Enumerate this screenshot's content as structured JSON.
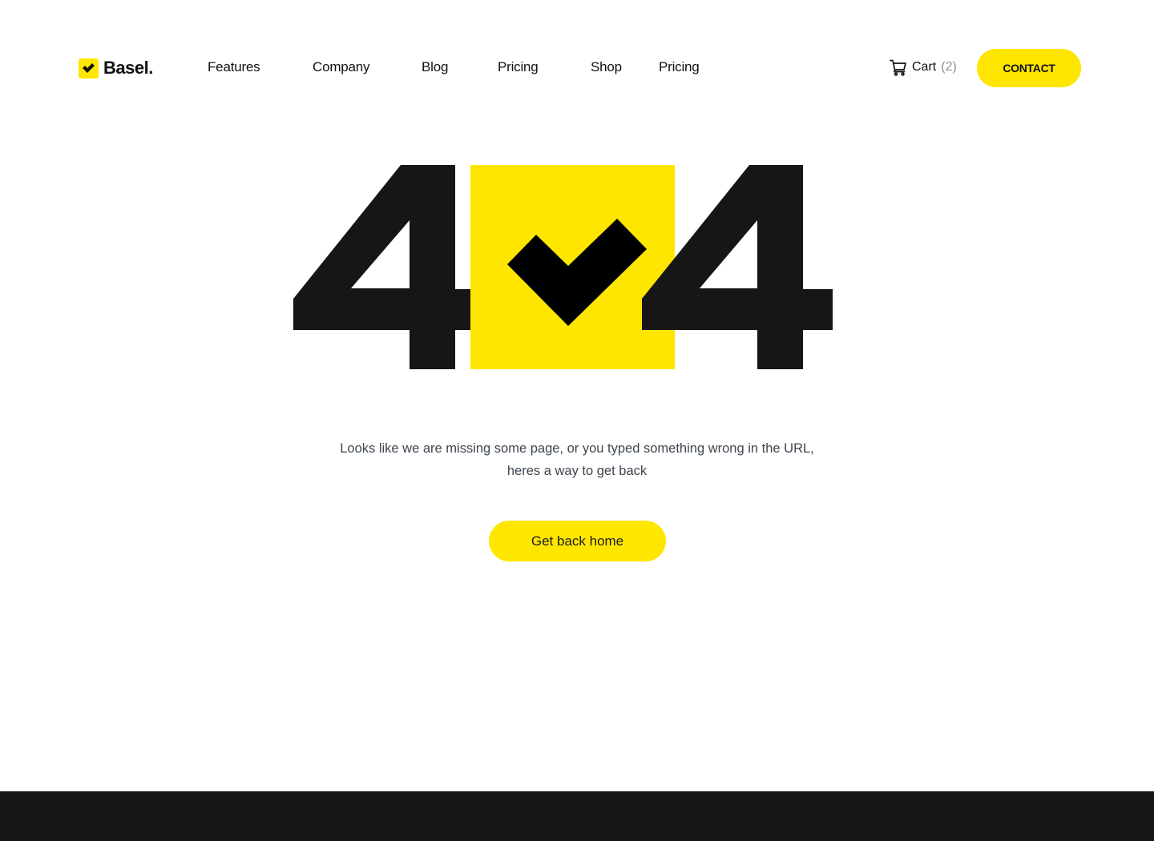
{
  "brand": {
    "name": "Basel.",
    "logo_icon": "checkmark-icon",
    "accent_color": "#ffe600",
    "dark_color": "#161616"
  },
  "nav": {
    "items": [
      {
        "label": "Features"
      },
      {
        "label": "Company"
      },
      {
        "label": "Blog"
      },
      {
        "label": "Pricing"
      },
      {
        "label": "Shop"
      },
      {
        "label": "Pricing"
      }
    ]
  },
  "cart": {
    "icon": "shopping-cart-icon",
    "label": "Cart",
    "count": "(2)"
  },
  "contact_button": {
    "label": "CONTACT"
  },
  "error": {
    "code_left": "4",
    "code_middle_icon": "checkmark-icon",
    "code_right": "4",
    "message_line1": "Looks like we are missing some page, or you typed something wrong in the URL,",
    "message_line2": "heres a way to get back",
    "home_button_label": "Get back home"
  }
}
